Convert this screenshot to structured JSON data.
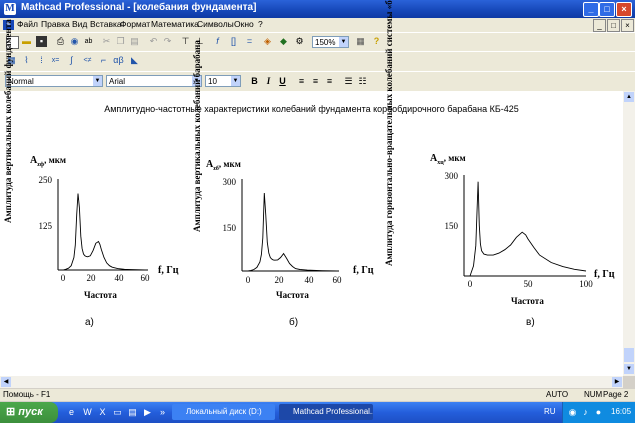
{
  "window": {
    "title": "Mathcad Professional - [колебания фундамента]",
    "buttons": [
      "_",
      "□",
      "×"
    ]
  },
  "menu": {
    "items": [
      "Файл",
      "Правка",
      "Вид",
      "Вставка",
      "Формат",
      "Математика",
      "Символы",
      "Окно",
      "?"
    ],
    "doc_buttons": [
      "_",
      "□",
      "×"
    ]
  },
  "toolbar": {
    "zoom": "150%"
  },
  "format_bar": {
    "style": "Normal",
    "font": "Arial",
    "size": "10",
    "bold": "B",
    "italic": "I",
    "underline": "U"
  },
  "document": {
    "heading": "Амплитудно-частотные характеристики колебаний фундамента корообдирочного барабана КБ-425",
    "charts": [
      {
        "caption": "а)",
        "ylabel": "Амплитуда вертикальных колебаний фундамента",
        "ytitle": "A",
        "ytitle_sub": "zф",
        "ytitle_unit": ", мкм",
        "xtitle": "f, Гц",
        "xlabel": "Частота",
        "yticks": [
          "250",
          "125"
        ],
        "xticks": [
          "0",
          "20",
          "40",
          "60"
        ]
      },
      {
        "caption": "б)",
        "ylabel": "Амплитуда вертикальных колебаний барабана",
        "ytitle": "A",
        "ytitle_sub": "zб",
        "ytitle_unit": ", мкм",
        "xtitle": "f, Гц",
        "xlabel": "Частота",
        "yticks": [
          "300",
          "150"
        ],
        "xticks": [
          "0",
          "20",
          "40",
          "60"
        ]
      },
      {
        "caption": "в)",
        "ylabel": "Амплитуда горизонтально-вращательных колебаний системы «барабан-фундамент» на уровне опорных роликов",
        "ytitle": "A",
        "ytitle_sub": "xц",
        "ytitle_unit": ", мкм",
        "xtitle": "f, Гц",
        "xlabel": "Частота",
        "yticks": [
          "300",
          "150"
        ],
        "xticks": [
          "0",
          "50",
          "100"
        ]
      }
    ]
  },
  "chart_data": [
    {
      "type": "line",
      "x": [
        0,
        2,
        4,
        6,
        8,
        9,
        10,
        11,
        12,
        13,
        14,
        15,
        16,
        17,
        18,
        20,
        22,
        24,
        26,
        27,
        28,
        30,
        32,
        34,
        36,
        40,
        45,
        50,
        60
      ],
      "y": [
        0,
        2,
        5,
        12,
        35,
        70,
        155,
        215,
        175,
        95,
        60,
        45,
        40,
        38,
        37,
        40,
        55,
        75,
        80,
        72,
        58,
        35,
        20,
        12,
        8,
        4,
        2,
        1,
        0
      ],
      "xlim": [
        0,
        60
      ],
      "ylim": [
        0,
        250
      ]
    },
    {
      "type": "line",
      "x": [
        0,
        2,
        4,
        6,
        8,
        9,
        10,
        11,
        12,
        13,
        14,
        15,
        16,
        17,
        18,
        20,
        22,
        24,
        26,
        28,
        30,
        32,
        35,
        40,
        50,
        60
      ],
      "y": [
        0,
        2,
        5,
        12,
        30,
        55,
        110,
        260,
        185,
        95,
        60,
        45,
        40,
        37,
        36,
        37,
        45,
        58,
        42,
        25,
        15,
        8,
        5,
        3,
        1,
        0
      ],
      "xlim": [
        0,
        60
      ],
      "ylim": [
        0,
        300
      ]
    },
    {
      "type": "line",
      "x": [
        0,
        3,
        5,
        6,
        7,
        8,
        9,
        10,
        12,
        15,
        20,
        25,
        30,
        35,
        40,
        45,
        48,
        50,
        55,
        60,
        70,
        80,
        90,
        100
      ],
      "y": [
        0,
        30,
        90,
        190,
        280,
        150,
        95,
        75,
        65,
        62,
        62,
        68,
        78,
        92,
        115,
        130,
        122,
        110,
        85,
        62,
        40,
        28,
        20,
        15
      ],
      "xlim": [
        0,
        100
      ],
      "ylim": [
        0,
        300
      ]
    }
  ],
  "status": {
    "help": "Помощь - F1",
    "mode": "AUTO",
    "num": "NUM",
    "page": "Page 2"
  },
  "taskbar": {
    "start": "пуск",
    "tasks": [
      "Локальный диск (D:)",
      "Mathcad Professional..."
    ],
    "lang": "RU",
    "time": "16:05"
  }
}
